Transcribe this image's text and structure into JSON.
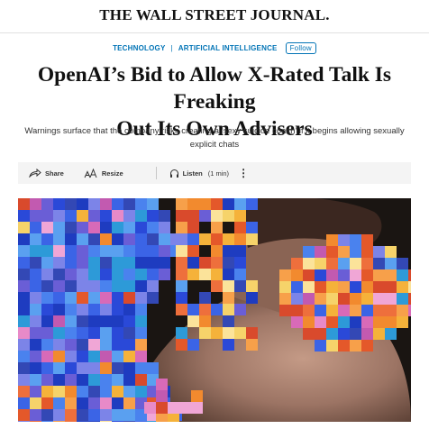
{
  "masthead": {
    "logo_text": "THE WALL STREET JOURNAL."
  },
  "breadcrumb": {
    "topic_1": "TECHNOLOGY",
    "separator": "|",
    "topic_2": "ARTIFICIAL INTELLIGENCE",
    "follow_label": "Follow"
  },
  "article": {
    "headline_line_1": "OpenAI’s Bid to Allow X-Rated Talk Is Freaking",
    "headline_line_2": "Out Its Own Advisers",
    "dek": "Warnings surface that the company risks creating a ‘sexy suicide coach’ if it begins allowing sexually explicit chats"
  },
  "toolbar": {
    "share_label": "Share",
    "share_icon": "share-icon",
    "resize_label": "Resize",
    "resize_icon": "text-resize-icon",
    "listen_label": "Listen",
    "listen_duration": "(1 min)",
    "listen_icon": "headphones-icon",
    "more_label": "⋮",
    "more_icon": "more-vertical-icon"
  },
  "hero_image": {
    "description_visible": false
  },
  "colors": {
    "accent": "#0274b6",
    "toolbar_bg": "#f4f4f4",
    "text": "#111111"
  }
}
